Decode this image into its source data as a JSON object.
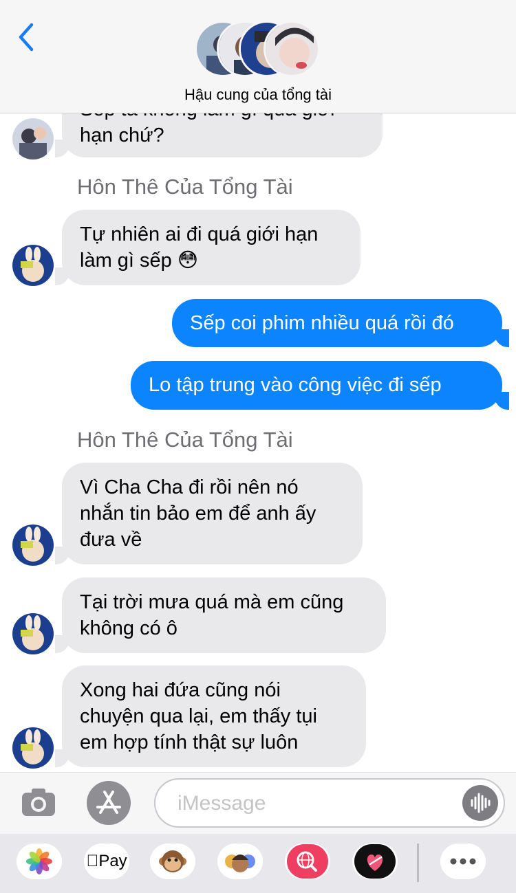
{
  "header": {
    "title": "Hậu cung của tổng tài",
    "back_icon": "chevron-left-icon"
  },
  "messages": [
    {
      "direction": "in",
      "lines": [
        "Sếp ta không làm gì quá giới",
        "hạn chứ?"
      ]
    },
    {
      "sender": "Hôn Thê Của Tổng Tài"
    },
    {
      "direction": "in",
      "lines": [
        "Tự nhiên ai đi quá giới hạn",
        "làm gì sếp 😳"
      ]
    },
    {
      "direction": "out",
      "lines": [
        "Sếp coi phim nhiều quá rồi đó"
      ]
    },
    {
      "direction": "out",
      "lines": [
        "Lo tập trung vào công việc đi sếp"
      ]
    },
    {
      "sender": "Hôn Thê Của Tổng Tài"
    },
    {
      "direction": "in",
      "lines": [
        "Vì Cha Cha đi rồi nên nó",
        "nhắn tin bảo em để anh ấy",
        "đưa về"
      ]
    },
    {
      "direction": "in",
      "lines": [
        "Tại trời mưa quá mà em cũng",
        "không có ô"
      ]
    },
    {
      "direction": "in",
      "lines": [
        "Xong hai đứa cũng nói",
        "chuyện qua lại, em thấy tụi",
        "em hợp tính thật sự luôn"
      ]
    }
  ],
  "input": {
    "placeholder": "iMessage",
    "camera_icon": "camera-icon",
    "appstore_icon": "app-store-icon",
    "audio_icon": "audio-waveform-icon"
  },
  "app_drawer": {
    "apple_pay_label": "Pay",
    "apps": [
      "photos-icon",
      "apple-pay-icon",
      "animoji-monkey-icon",
      "memoji-icon",
      "web-search-icon",
      "digital-touch-icon",
      "more-icon"
    ]
  },
  "colors": {
    "incoming_bubble": "#e9e9eb",
    "outgoing_bubble": "#0b84fe",
    "accent": "#1a7cf5"
  }
}
